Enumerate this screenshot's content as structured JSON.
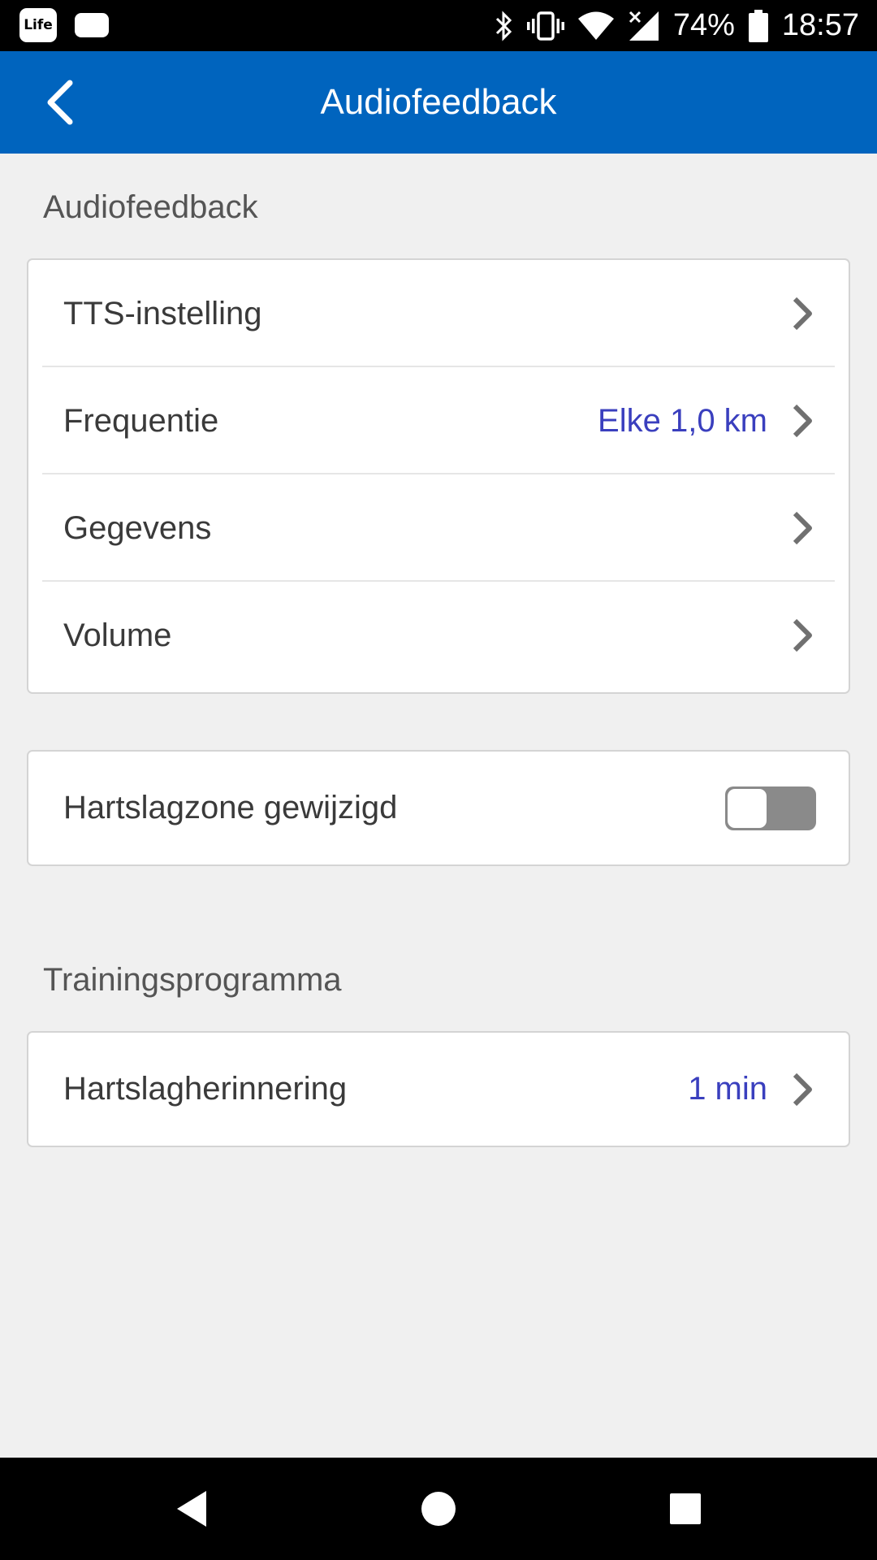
{
  "status_bar": {
    "battery_percent": "74%",
    "time": "18:57",
    "app_badge": "Life",
    "icons": [
      "life-app-icon",
      "message-icon",
      "bluetooth-icon",
      "vibrate-icon",
      "wifi-icon",
      "signal-icon",
      "battery-icon"
    ]
  },
  "app_bar": {
    "title": "Audiofeedback",
    "back_icon": "chevron-left-icon"
  },
  "sections": {
    "audiofeedback": {
      "label": "Audiofeedback",
      "rows": [
        {
          "label": "TTS-instelling",
          "value": ""
        },
        {
          "label": "Frequentie",
          "value": "Elke 1,0 km"
        },
        {
          "label": "Gegevens",
          "value": ""
        },
        {
          "label": "Volume",
          "value": ""
        }
      ]
    },
    "heart_zone": {
      "label": "Hartslagzone gewijzigd",
      "toggle_on": false
    },
    "training": {
      "label": "Trainingsprogramma",
      "rows": [
        {
          "label": "Hartslagherinnering",
          "value": "1 min"
        }
      ]
    }
  },
  "colors": {
    "app_bar": "#0064be",
    "value_text": "#3a3fbe",
    "background": "#f0f0f0"
  },
  "nav_bar": {
    "icons": [
      "back-triangle-icon",
      "home-circle-icon",
      "recents-square-icon"
    ]
  }
}
